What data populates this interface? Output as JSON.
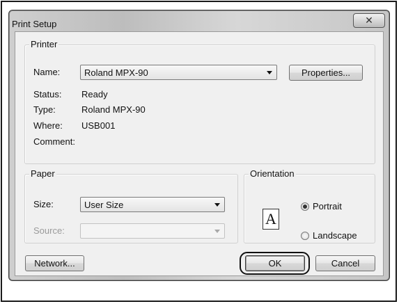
{
  "window": {
    "title": "Print Setup",
    "close_glyph": "✕"
  },
  "printer": {
    "group_label": "Printer",
    "name_label": "Name:",
    "name_value": "Roland MPX-90",
    "properties_button": "Properties...",
    "status_label": "Status:",
    "status_value": "Ready",
    "type_label": "Type:",
    "type_value": "Roland MPX-90",
    "where_label": "Where:",
    "where_value": "USB001",
    "comment_label": "Comment:",
    "comment_value": ""
  },
  "paper": {
    "group_label": "Paper",
    "size_label": "Size:",
    "size_value": "User Size",
    "source_label": "Source:",
    "source_value": ""
  },
  "orientation": {
    "group_label": "Orientation",
    "icon_letter": "A",
    "portrait_label": "Portrait",
    "landscape_label": "Landscape",
    "selected": "Portrait"
  },
  "buttons": {
    "network": "Network...",
    "ok": "OK",
    "cancel": "Cancel"
  }
}
